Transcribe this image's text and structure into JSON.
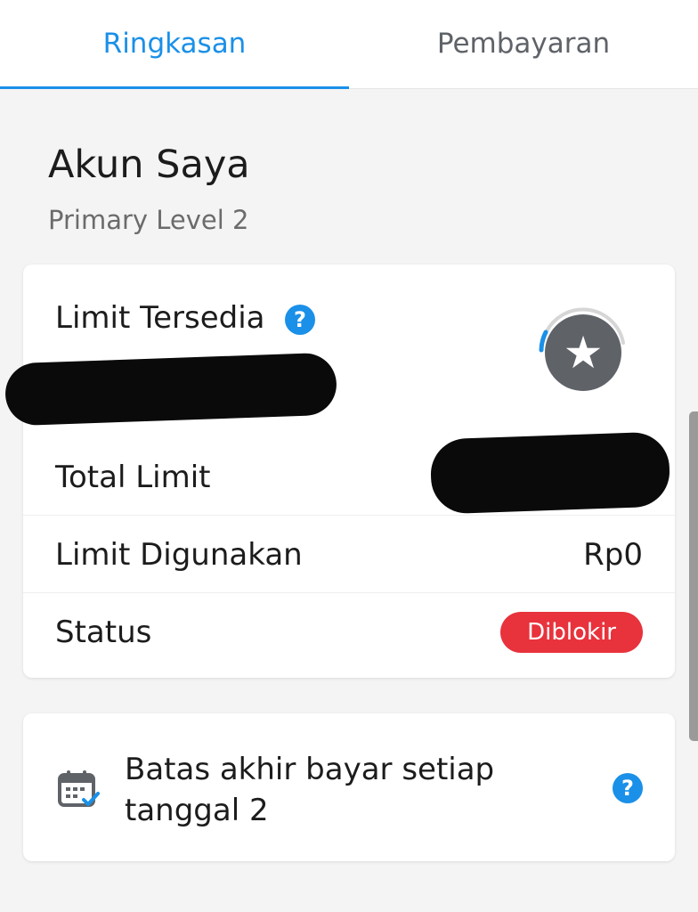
{
  "tabs": [
    {
      "label": "Ringkasan",
      "active": true
    },
    {
      "label": "Pembayaran",
      "active": false
    }
  ],
  "header": {
    "title": "Akun Saya",
    "subtitle": "Primary Level 2"
  },
  "limit_card": {
    "label": "Limit Tersedia",
    "help_icon": "question-icon",
    "badge_icon": "star-icon",
    "rows": [
      {
        "label": "Total Limit",
        "value": ""
      },
      {
        "label": "Limit Digunakan",
        "value": "Rp0"
      },
      {
        "label": "Status",
        "value": "Diblokir"
      }
    ]
  },
  "due_card": {
    "icon": "calendar-icon",
    "text": "Batas akhir bayar setiap tanggal 2",
    "help_icon": "question-icon"
  },
  "colors": {
    "accent": "#1a90e8",
    "status_blocked": "#e8323c",
    "badge": "#5f6368"
  }
}
